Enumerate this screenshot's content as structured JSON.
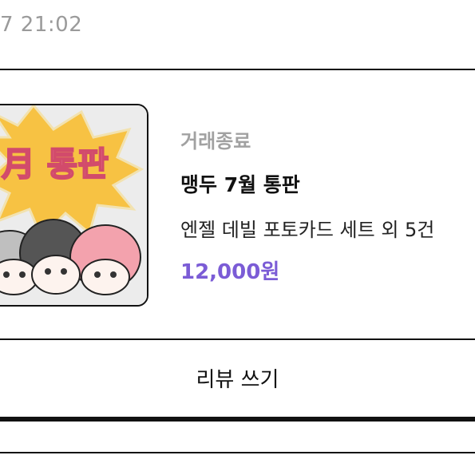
{
  "header": {
    "timestamp": "7 21:02"
  },
  "order": {
    "thumbnail": {
      "alt_icon": "product-thumbnail",
      "overlay_text": "月 통판"
    },
    "status": "거래종료",
    "title": "맹두 7월 통판",
    "subtitle": "엔젤 데빌 포토카드 세트 외 5건",
    "price": "12,000원",
    "price_color": "#7b5cd6"
  },
  "actions": {
    "review_label": "리뷰 쓰기"
  }
}
